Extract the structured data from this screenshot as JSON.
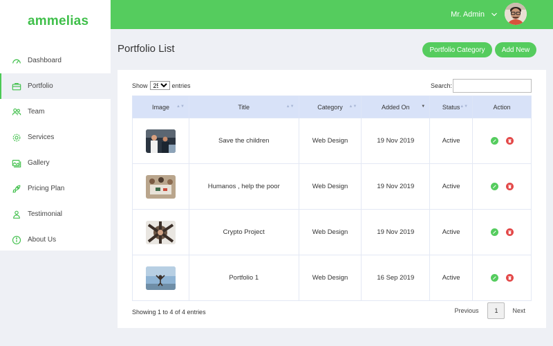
{
  "brand": {
    "name": "ammelias",
    "accent": "#55cc5e"
  },
  "sidebar": {
    "items": [
      {
        "label": "Dashboard",
        "icon": "gauge-icon"
      },
      {
        "label": "Portfolio",
        "icon": "briefcase-icon",
        "active": true
      },
      {
        "label": "Team",
        "icon": "team-icon"
      },
      {
        "label": "Services",
        "icon": "gear-icon"
      },
      {
        "label": "Gallery",
        "icon": "gallery-icon"
      },
      {
        "label": "Pricing Plan",
        "icon": "rocket-icon"
      },
      {
        "label": "Testimonial",
        "icon": "testimonial-icon"
      },
      {
        "label": "About Us",
        "icon": "info-icon"
      }
    ]
  },
  "topbar": {
    "user_name": "Mr. Admin"
  },
  "header": {
    "title": "Portfolio List",
    "category_button": "Portfolio Category",
    "add_button": "Add New"
  },
  "table_controls": {
    "show_label": "Show",
    "entries_value": "25",
    "entries_label": "entries",
    "search_label": "Search:",
    "search_value": ""
  },
  "table": {
    "columns": [
      "Image",
      "Title",
      "Category",
      "Added On",
      "Status",
      "Action"
    ],
    "rows": [
      {
        "title": "Save the children",
        "category": "Web Design",
        "added_on": "19 Nov 2019",
        "status": "Active",
        "image": "photo-people-working"
      },
      {
        "title": "Humanos , help the poor",
        "category": "Web Design",
        "added_on": "19 Nov 2019",
        "status": "Active",
        "image": "photo-meeting-table"
      },
      {
        "title": "Crypto Project",
        "category": "Web Design",
        "added_on": "19 Nov 2019",
        "status": "Active",
        "image": "photo-team-hands"
      },
      {
        "title": "Portfolio 1",
        "category": "Web Design",
        "added_on": "16 Sep 2019",
        "status": "Active",
        "image": "photo-sky-celebration"
      }
    ]
  },
  "footer": {
    "info": "Showing 1 to 4 of 4 entries",
    "previous": "Previous",
    "page": "1",
    "next": "Next"
  }
}
